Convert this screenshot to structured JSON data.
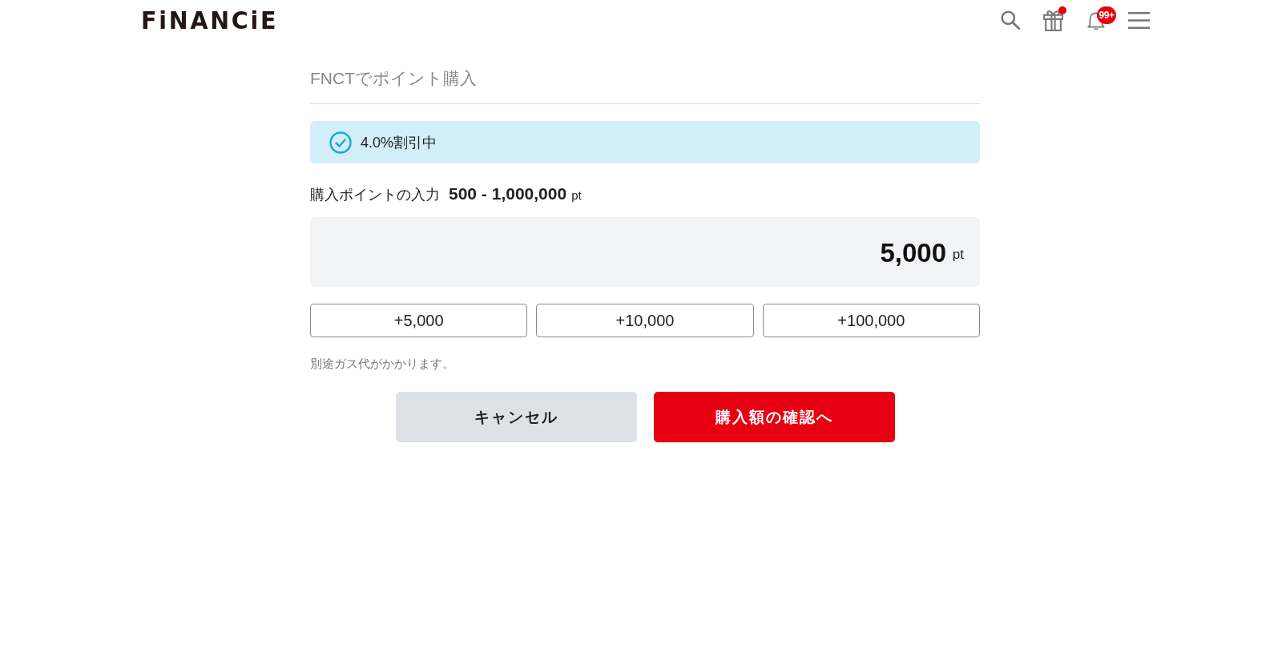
{
  "header": {
    "logo": "FiNANCiE",
    "icons": [
      {
        "kind": "search"
      },
      {
        "kind": "gift",
        "dot": true
      },
      {
        "kind": "bell",
        "badge": "99+"
      },
      {
        "kind": "menu"
      }
    ]
  },
  "page_title": "FNCTでポイント購入",
  "banner": {
    "text": "4.0%割引中"
  },
  "amount": {
    "label": "購入ポイントの入力",
    "range": "500 - 1,000,000",
    "range_unit": "pt",
    "value": "5,000",
    "unit": "pt"
  },
  "quick_add": [
    "+5,000",
    "+10,000",
    "+100,000"
  ],
  "note": "別途ガス代がかかります。",
  "actions": [
    {
      "label": "キャンセル",
      "kind": "secondary"
    },
    {
      "label": "購入額の確認へ",
      "kind": "primary"
    }
  ]
}
